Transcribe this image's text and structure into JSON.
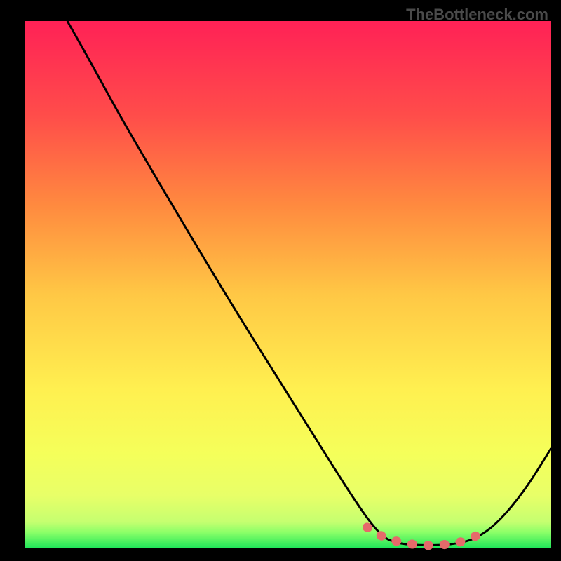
{
  "watermark": "TheBottleneck.com",
  "chart_data": {
    "type": "line",
    "title": "",
    "xlabel": "",
    "ylabel": "",
    "xlim": [
      0,
      100
    ],
    "ylim": [
      0,
      100
    ],
    "gradient_colors": {
      "top": "#ff2156",
      "upper_mid": "#ff7a45",
      "mid": "#ffc845",
      "lower_mid": "#fff050",
      "lower": "#f2ff60",
      "bottom_yellow": "#e0ff70",
      "bottom_green": "#1de559"
    },
    "curve_points": [
      {
        "x": 8,
        "y": 100
      },
      {
        "x": 12,
        "y": 93
      },
      {
        "x": 18,
        "y": 82
      },
      {
        "x": 28,
        "y": 65
      },
      {
        "x": 40,
        "y": 45
      },
      {
        "x": 52,
        "y": 26
      },
      {
        "x": 62,
        "y": 10
      },
      {
        "x": 67,
        "y": 3
      },
      {
        "x": 70,
        "y": 1
      },
      {
        "x": 76,
        "y": 0.5
      },
      {
        "x": 82,
        "y": 0.8
      },
      {
        "x": 86,
        "y": 2
      },
      {
        "x": 90,
        "y": 5
      },
      {
        "x": 95,
        "y": 11
      },
      {
        "x": 100,
        "y": 19
      }
    ],
    "highlighted_segment": {
      "color": "#e56a6a",
      "points": [
        {
          "x": 65,
          "y": 4
        },
        {
          "x": 68,
          "y": 2
        },
        {
          "x": 72,
          "y": 1
        },
        {
          "x": 76,
          "y": 0.5
        },
        {
          "x": 80,
          "y": 0.7
        },
        {
          "x": 83,
          "y": 1.2
        },
        {
          "x": 86,
          "y": 2.5
        }
      ]
    }
  }
}
